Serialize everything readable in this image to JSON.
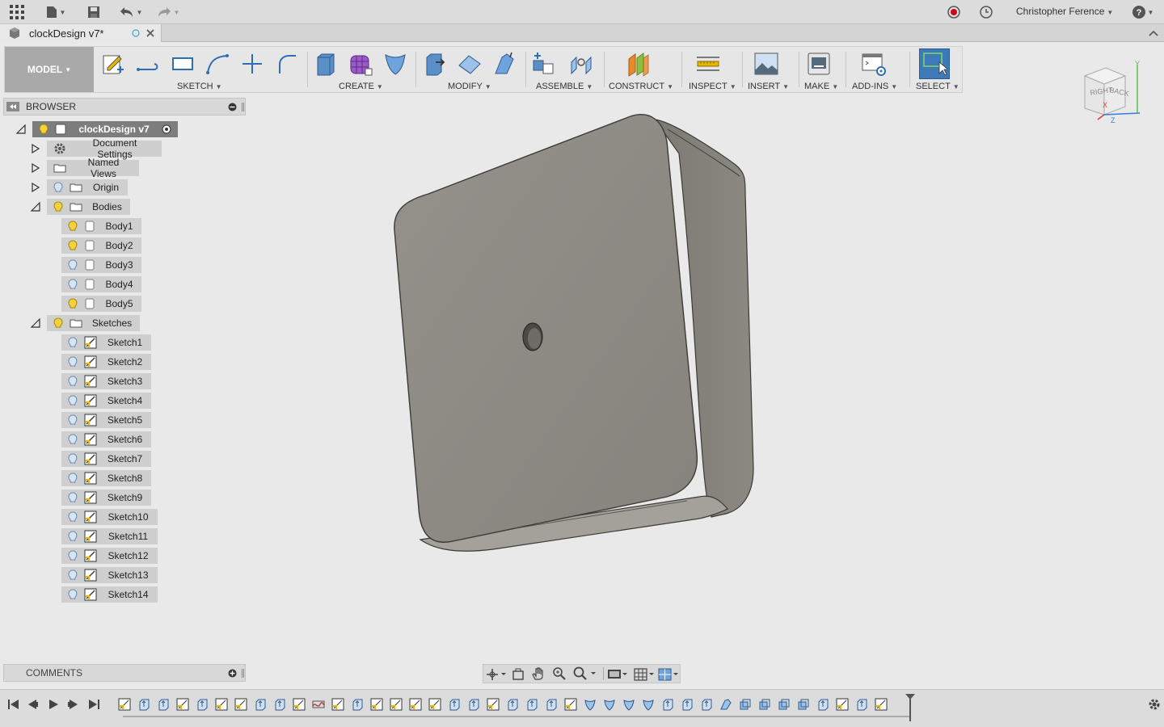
{
  "app": {
    "user_name": "Christopher Ference"
  },
  "document": {
    "tab_title": "clockDesign v7*"
  },
  "toolbar": {
    "model_label": "MODEL",
    "groups": {
      "sketch": "SKETCH",
      "create": "CREATE",
      "modify": "MODIFY",
      "assemble": "ASSEMBLE",
      "construct": "CONSTRUCT",
      "inspect": "INSPECT",
      "insert": "INSERT",
      "make": "MAKE",
      "addins": "ADD-INS",
      "select": "SELECT"
    }
  },
  "browser": {
    "title": "BROWSER",
    "root": "clockDesign v7",
    "document_settings": "Document Settings",
    "named_views": "Named Views",
    "origin": "Origin",
    "bodies_label": "Bodies",
    "bodies": [
      "Body1",
      "Body2",
      "Body3",
      "Body4",
      "Body5"
    ],
    "sketches_label": "Sketches",
    "sketches": [
      "Sketch1",
      "Sketch2",
      "Sketch3",
      "Sketch4",
      "Sketch5",
      "Sketch6",
      "Sketch7",
      "Sketch8",
      "Sketch9",
      "Sketch10",
      "Sketch11",
      "Sketch12",
      "Sketch13",
      "Sketch14"
    ]
  },
  "viewcube": {
    "right": "RIGHT",
    "back": "BACK",
    "x": "X",
    "y": "Y",
    "z": "Z"
  },
  "comments": {
    "title": "COMMENTS"
  },
  "colors": {
    "accent_blue": "#2e6db4",
    "sketch_yellow": "#e8b800",
    "select_active": "#3e7ab8",
    "body_gray": "#8f8d86"
  }
}
